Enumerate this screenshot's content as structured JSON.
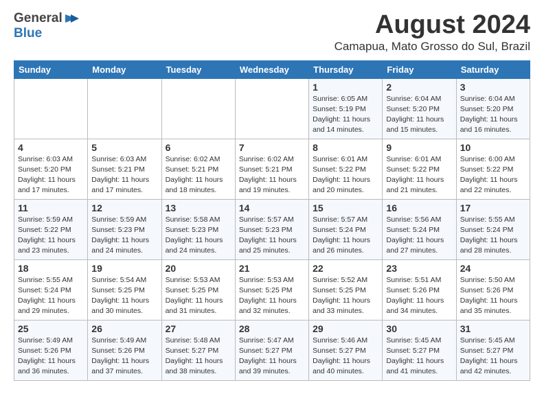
{
  "header": {
    "logo_general": "General",
    "logo_blue": "Blue",
    "title": "August 2024",
    "location": "Camapua, Mato Grosso do Sul, Brazil"
  },
  "calendar": {
    "days_of_week": [
      "Sunday",
      "Monday",
      "Tuesday",
      "Wednesday",
      "Thursday",
      "Friday",
      "Saturday"
    ],
    "weeks": [
      [
        {
          "day": "",
          "info": ""
        },
        {
          "day": "",
          "info": ""
        },
        {
          "day": "",
          "info": ""
        },
        {
          "day": "",
          "info": ""
        },
        {
          "day": "1",
          "info": "Sunrise: 6:05 AM\nSunset: 5:19 PM\nDaylight: 11 hours\nand 14 minutes."
        },
        {
          "day": "2",
          "info": "Sunrise: 6:04 AM\nSunset: 5:20 PM\nDaylight: 11 hours\nand 15 minutes."
        },
        {
          "day": "3",
          "info": "Sunrise: 6:04 AM\nSunset: 5:20 PM\nDaylight: 11 hours\nand 16 minutes."
        }
      ],
      [
        {
          "day": "4",
          "info": "Sunrise: 6:03 AM\nSunset: 5:20 PM\nDaylight: 11 hours\nand 17 minutes."
        },
        {
          "day": "5",
          "info": "Sunrise: 6:03 AM\nSunset: 5:21 PM\nDaylight: 11 hours\nand 17 minutes."
        },
        {
          "day": "6",
          "info": "Sunrise: 6:02 AM\nSunset: 5:21 PM\nDaylight: 11 hours\nand 18 minutes."
        },
        {
          "day": "7",
          "info": "Sunrise: 6:02 AM\nSunset: 5:21 PM\nDaylight: 11 hours\nand 19 minutes."
        },
        {
          "day": "8",
          "info": "Sunrise: 6:01 AM\nSunset: 5:22 PM\nDaylight: 11 hours\nand 20 minutes."
        },
        {
          "day": "9",
          "info": "Sunrise: 6:01 AM\nSunset: 5:22 PM\nDaylight: 11 hours\nand 21 minutes."
        },
        {
          "day": "10",
          "info": "Sunrise: 6:00 AM\nSunset: 5:22 PM\nDaylight: 11 hours\nand 22 minutes."
        }
      ],
      [
        {
          "day": "11",
          "info": "Sunrise: 5:59 AM\nSunset: 5:22 PM\nDaylight: 11 hours\nand 23 minutes."
        },
        {
          "day": "12",
          "info": "Sunrise: 5:59 AM\nSunset: 5:23 PM\nDaylight: 11 hours\nand 24 minutes."
        },
        {
          "day": "13",
          "info": "Sunrise: 5:58 AM\nSunset: 5:23 PM\nDaylight: 11 hours\nand 24 minutes."
        },
        {
          "day": "14",
          "info": "Sunrise: 5:57 AM\nSunset: 5:23 PM\nDaylight: 11 hours\nand 25 minutes."
        },
        {
          "day": "15",
          "info": "Sunrise: 5:57 AM\nSunset: 5:24 PM\nDaylight: 11 hours\nand 26 minutes."
        },
        {
          "day": "16",
          "info": "Sunrise: 5:56 AM\nSunset: 5:24 PM\nDaylight: 11 hours\nand 27 minutes."
        },
        {
          "day": "17",
          "info": "Sunrise: 5:55 AM\nSunset: 5:24 PM\nDaylight: 11 hours\nand 28 minutes."
        }
      ],
      [
        {
          "day": "18",
          "info": "Sunrise: 5:55 AM\nSunset: 5:24 PM\nDaylight: 11 hours\nand 29 minutes."
        },
        {
          "day": "19",
          "info": "Sunrise: 5:54 AM\nSunset: 5:25 PM\nDaylight: 11 hours\nand 30 minutes."
        },
        {
          "day": "20",
          "info": "Sunrise: 5:53 AM\nSunset: 5:25 PM\nDaylight: 11 hours\nand 31 minutes."
        },
        {
          "day": "21",
          "info": "Sunrise: 5:53 AM\nSunset: 5:25 PM\nDaylight: 11 hours\nand 32 minutes."
        },
        {
          "day": "22",
          "info": "Sunrise: 5:52 AM\nSunset: 5:25 PM\nDaylight: 11 hours\nand 33 minutes."
        },
        {
          "day": "23",
          "info": "Sunrise: 5:51 AM\nSunset: 5:26 PM\nDaylight: 11 hours\nand 34 minutes."
        },
        {
          "day": "24",
          "info": "Sunrise: 5:50 AM\nSunset: 5:26 PM\nDaylight: 11 hours\nand 35 minutes."
        }
      ],
      [
        {
          "day": "25",
          "info": "Sunrise: 5:49 AM\nSunset: 5:26 PM\nDaylight: 11 hours\nand 36 minutes."
        },
        {
          "day": "26",
          "info": "Sunrise: 5:49 AM\nSunset: 5:26 PM\nDaylight: 11 hours\nand 37 minutes."
        },
        {
          "day": "27",
          "info": "Sunrise: 5:48 AM\nSunset: 5:27 PM\nDaylight: 11 hours\nand 38 minutes."
        },
        {
          "day": "28",
          "info": "Sunrise: 5:47 AM\nSunset: 5:27 PM\nDaylight: 11 hours\nand 39 minutes."
        },
        {
          "day": "29",
          "info": "Sunrise: 5:46 AM\nSunset: 5:27 PM\nDaylight: 11 hours\nand 40 minutes."
        },
        {
          "day": "30",
          "info": "Sunrise: 5:45 AM\nSunset: 5:27 PM\nDaylight: 11 hours\nand 41 minutes."
        },
        {
          "day": "31",
          "info": "Sunrise: 5:45 AM\nSunset: 5:27 PM\nDaylight: 11 hours\nand 42 minutes."
        }
      ]
    ]
  }
}
